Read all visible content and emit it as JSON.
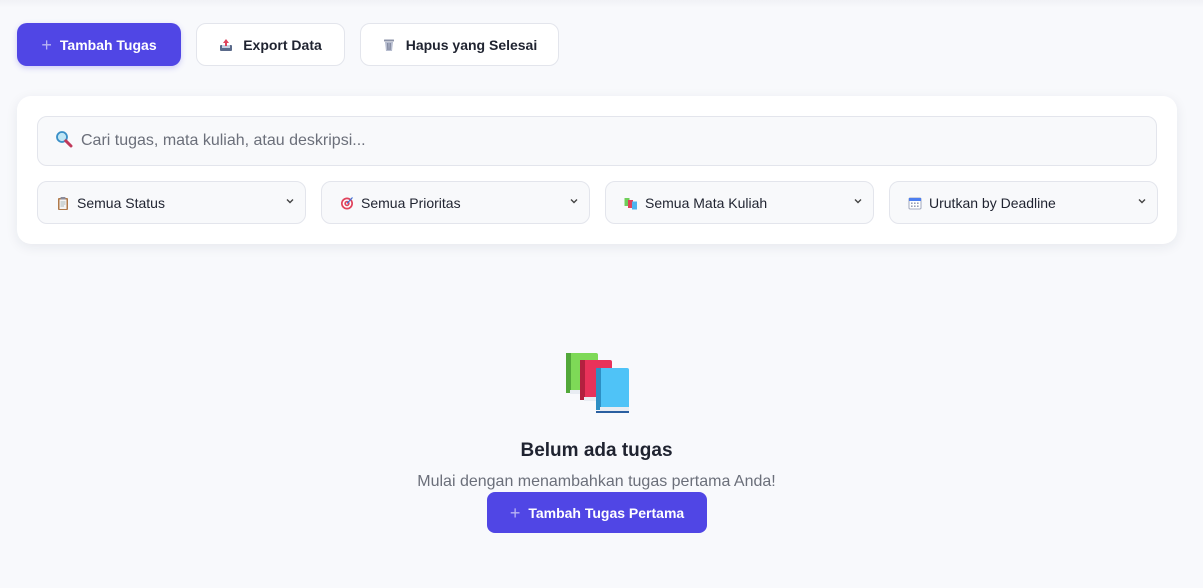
{
  "toolbar": {
    "add_label": "Tambah Tugas",
    "export_label": "Export Data",
    "clear_label": "Hapus yang Selesai"
  },
  "search": {
    "placeholder": "Cari tugas, mata kuliah, atau deskripsi..."
  },
  "filters": [
    {
      "label": "Semua Status",
      "icon": "clipboard-icon"
    },
    {
      "label": "Semua Prioritas",
      "icon": "target-icon"
    },
    {
      "label": "Semua Mata Kuliah",
      "icon": "books-icon"
    },
    {
      "label": "Urutkan by Deadline",
      "icon": "calendar-icon"
    }
  ],
  "empty_state": {
    "icon": "books-icon",
    "title": "Belum ada tugas",
    "subtitle": "Mulai dengan menambahkan tugas pertama Anda!",
    "button_label": "Tambah Tugas Pertama"
  },
  "colors": {
    "primary": "#5046e5",
    "background": "#f8f9fc"
  }
}
